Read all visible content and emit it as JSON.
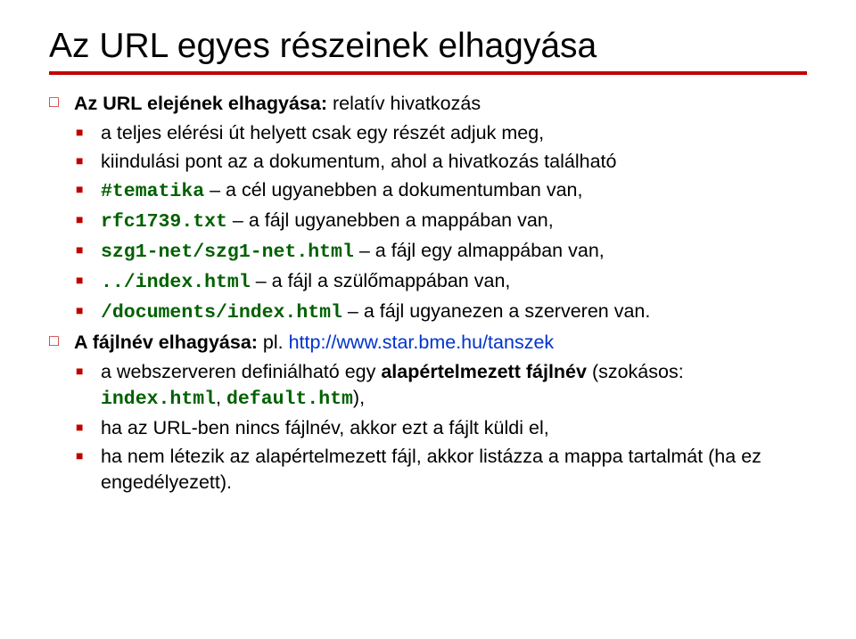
{
  "title": "Az URL egyes részeinek elhagyása",
  "bullets": {
    "b1": "Az URL elejének elhagyása:",
    "b1_tail": " relatív hivatkozás",
    "b1_1": "a teljes elérési út helyett csak egy részét adjuk meg,",
    "b1_2": "kiindulási pont az a dokumentum, ahol a hivatkozás található",
    "b1_3_code": "#tematika",
    "b1_3_tail": " – a cél ugyanebben a dokumentumban van,",
    "b1_4_code": "rfc1739.txt",
    "b1_4_tail": " – a fájl ugyanebben a mappában van,",
    "b1_5_code": "szg1-net/szg1-net.html",
    "b1_5_tail": " – a fájl egy almappában van,",
    "b1_6_code": "../index.html",
    "b1_6_tail": " – a fájl a szülőmappában van,",
    "b1_7_code": "/documents/index.html",
    "b1_7_tail": " – a fájl ugyanezen a szerveren van.",
    "b2": "A fájlnév elhagyása:",
    "b2_tail_pre": " pl. ",
    "b2_url": "http://www.star.bme.hu/tanszek",
    "b2_1_pre": "a webszerveren definiálható egy ",
    "b2_1_bold": "alapértelmezett fájlnév",
    "b2_1_mid": " (szokásos: ",
    "b2_1_code1": "index.html",
    "b2_1_comma": ", ",
    "b2_1_code2": "default.htm",
    "b2_1_end": "),",
    "b2_2": "ha az URL-ben nincs fájlnév, akkor ezt a fájlt küldi el,",
    "b2_3": "ha nem létezik az alapértelmezett fájl, akkor listázza a mappa tartalmát (ha ez engedélyezett)."
  }
}
